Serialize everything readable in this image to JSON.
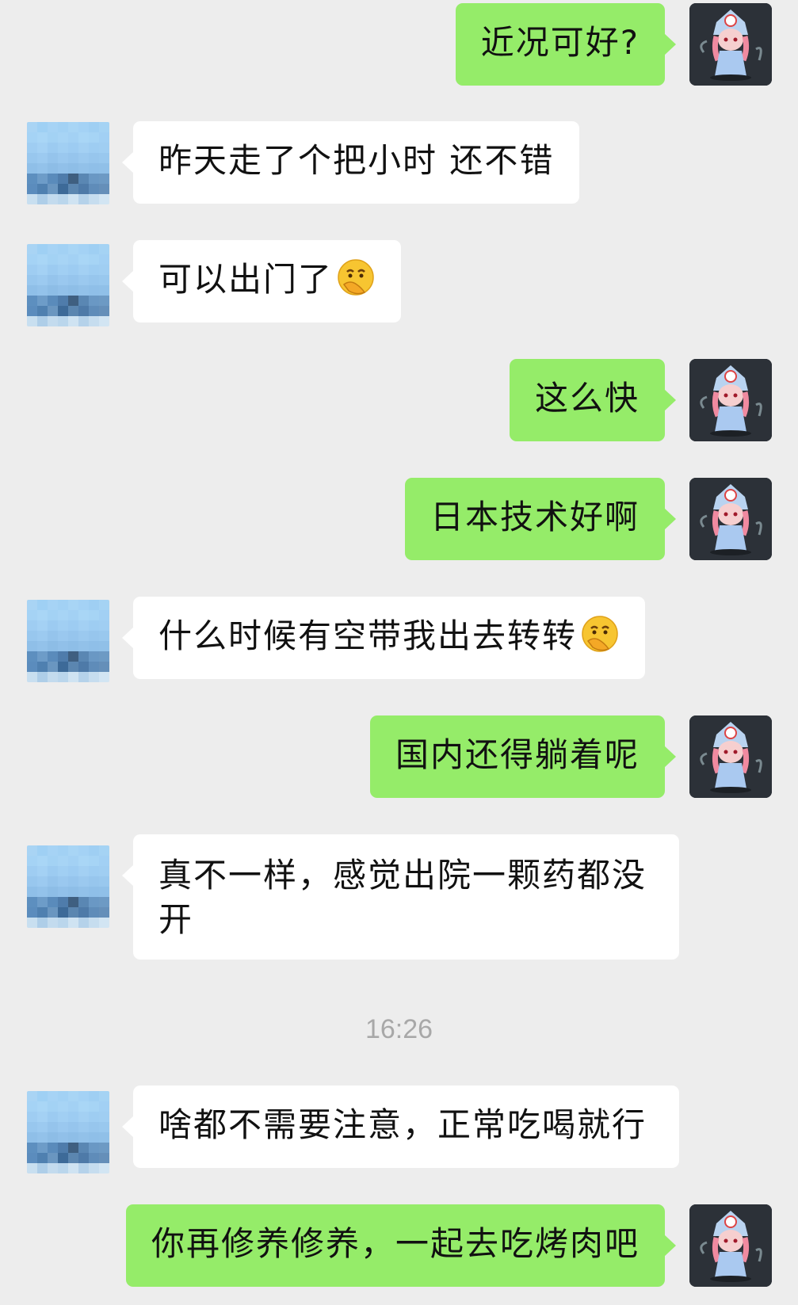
{
  "colors": {
    "background": "#ededed",
    "self_bubble": "#95ec69",
    "other_bubble": "#ffffff",
    "timestamp": "#a8a8a8"
  },
  "messages": [
    {
      "sender": "self",
      "text": "近况可好?"
    },
    {
      "sender": "other",
      "text": "昨天走了个把小时 还不错"
    },
    {
      "sender": "other",
      "text": "可以出门了",
      "emoji": "thinking-face-emoji"
    },
    {
      "sender": "self",
      "text": "这么快"
    },
    {
      "sender": "self",
      "text": "日本技术好啊"
    },
    {
      "sender": "other",
      "text": "什么时候有空带我出去转转",
      "emoji": "thinking-face-emoji"
    },
    {
      "sender": "self",
      "text": "国内还得躺着呢"
    },
    {
      "sender": "other",
      "text": "真不一样，感觉出院一颗药都没开"
    },
    {
      "sender": "other",
      "text": "啥都不需要注意，正常吃喝就行"
    },
    {
      "sender": "self",
      "text": "你再修养修养，一起去吃烤肉吧"
    }
  ],
  "timestamp": "16:26"
}
